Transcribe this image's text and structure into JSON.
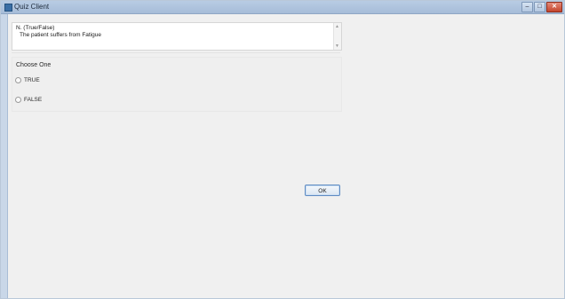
{
  "window": {
    "title": "Quiz Client",
    "controls": {
      "minimize": "–",
      "maximize": "□",
      "close": "✕"
    }
  },
  "question": {
    "number": "N. (True/False)",
    "text": "The patient suffers from Fatigue"
  },
  "answers": {
    "prompt": "Choose One",
    "options": [
      "TRUE",
      "FALSE"
    ]
  },
  "ok_button": {
    "label": "OK"
  }
}
